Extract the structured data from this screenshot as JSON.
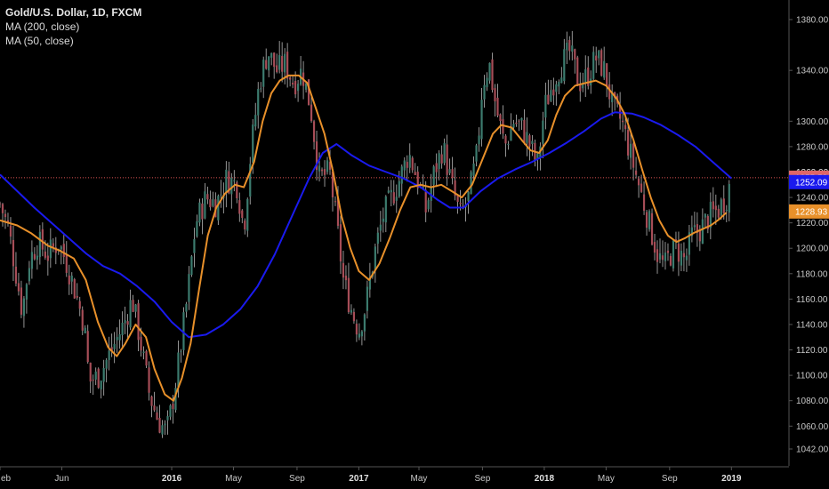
{
  "legend": {
    "title": "Gold/U.S. Dollar, 1D, FXCM",
    "ma200": "MA (200, close)",
    "ma50": "MA (50, close)"
  },
  "colors": {
    "background": "#000000",
    "candle_up": "#3c7b6e",
    "candle_down": "#a64d57",
    "wick": "#b8b8b8",
    "ma200": "#1a1aee",
    "ma50": "#e8902a",
    "price_line": "#e05555",
    "axis": "#555555"
  },
  "chart_data": {
    "type": "line",
    "title": "Gold/U.S. Dollar, 1D, FXCM",
    "xlabel": "",
    "ylabel": "",
    "ylim": [
      1030,
      1390
    ],
    "xlim": [
      0,
      45.9
    ],
    "y_ticks": [
      1042.0,
      1060.0,
      1080.0,
      1100.0,
      1120.0,
      1140.0,
      1160.0,
      1180.0,
      1200.0,
      1220.0,
      1240.0,
      1260.0,
      1280.0,
      1300.0,
      1340.0,
      1380.0
    ],
    "x_ticks": [
      {
        "t": 0,
        "label": "eb",
        "bold": false
      },
      {
        "t": 3.6,
        "label": "Jun",
        "bold": false
      },
      {
        "t": 10.0,
        "label": "2016",
        "bold": true
      },
      {
        "t": 13.6,
        "label": "May",
        "bold": false
      },
      {
        "t": 17.3,
        "label": "Sep",
        "bold": false
      },
      {
        "t": 20.9,
        "label": "2017",
        "bold": true
      },
      {
        "t": 24.4,
        "label": "May",
        "bold": false
      },
      {
        "t": 28.1,
        "label": "Sep",
        "bold": false
      },
      {
        "t": 31.7,
        "label": "2018",
        "bold": true
      },
      {
        "t": 35.3,
        "label": "May",
        "bold": false
      },
      {
        "t": 39.0,
        "label": "Sep",
        "bold": false
      },
      {
        "t": 42.6,
        "label": "2019",
        "bold": true
      }
    ],
    "grid": false,
    "legend_position": "top-left",
    "price": [
      [
        0,
        1235
      ],
      [
        0.5,
        1215
      ],
      [
        1.0,
        1175
      ],
      [
        1.3,
        1150
      ],
      [
        1.7,
        1190
      ],
      [
        2.2,
        1205
      ],
      [
        2.8,
        1195
      ],
      [
        3.4,
        1205
      ],
      [
        3.9,
        1188
      ],
      [
        4.4,
        1165
      ],
      [
        4.9,
        1140
      ],
      [
        5.2,
        1095
      ],
      [
        5.8,
        1100
      ],
      [
        6.5,
        1120
      ],
      [
        7.2,
        1140
      ],
      [
        7.7,
        1160
      ],
      [
        8.2,
        1125
      ],
      [
        8.7,
        1085
      ],
      [
        9.2,
        1065
      ],
      [
        9.7,
        1055
      ],
      [
        10.0,
        1075
      ],
      [
        10.4,
        1110
      ],
      [
        10.9,
        1160
      ],
      [
        11.4,
        1220
      ],
      [
        12.0,
        1240
      ],
      [
        12.6,
        1235
      ],
      [
        13.2,
        1255
      ],
      [
        13.8,
        1250
      ],
      [
        14.2,
        1215
      ],
      [
        14.6,
        1275
      ],
      [
        15.1,
        1330
      ],
      [
        15.6,
        1355
      ],
      [
        16.1,
        1340
      ],
      [
        16.6,
        1345
      ],
      [
        17.1,
        1330
      ],
      [
        17.6,
        1340
      ],
      [
        18.1,
        1310
      ],
      [
        18.6,
        1255
      ],
      [
        19.2,
        1260
      ],
      [
        19.6,
        1220
      ],
      [
        20.0,
        1175
      ],
      [
        20.5,
        1150
      ],
      [
        20.9,
        1135
      ],
      [
        21.3,
        1155
      ],
      [
        21.8,
        1195
      ],
      [
        22.3,
        1225
      ],
      [
        22.8,
        1240
      ],
      [
        23.3,
        1255
      ],
      [
        23.8,
        1275
      ],
      [
        24.3,
        1255
      ],
      [
        24.8,
        1230
      ],
      [
        25.3,
        1260
      ],
      [
        25.8,
        1280
      ],
      [
        26.3,
        1250
      ],
      [
        26.8,
        1225
      ],
      [
        27.3,
        1240
      ],
      [
        27.8,
        1275
      ],
      [
        28.1,
        1330
      ],
      [
        28.5,
        1345
      ],
      [
        28.9,
        1310
      ],
      [
        29.4,
        1280
      ],
      [
        29.9,
        1300
      ],
      [
        30.4,
        1295
      ],
      [
        30.9,
        1280
      ],
      [
        31.3,
        1265
      ],
      [
        31.7,
        1310
      ],
      [
        32.2,
        1330
      ],
      [
        32.7,
        1345
      ],
      [
        33.2,
        1355
      ],
      [
        33.7,
        1330
      ],
      [
        34.2,
        1335
      ],
      [
        34.7,
        1350
      ],
      [
        35.2,
        1340
      ],
      [
        35.7,
        1310
      ],
      [
        36.2,
        1300
      ],
      [
        36.6,
        1280
      ],
      [
        37.1,
        1255
      ],
      [
        37.5,
        1235
      ],
      [
        37.9,
        1215
      ],
      [
        38.3,
        1195
      ],
      [
        38.7,
        1185
      ],
      [
        39.0,
        1195
      ],
      [
        39.4,
        1200
      ],
      [
        39.9,
        1190
      ],
      [
        40.3,
        1210
      ],
      [
        40.8,
        1215
      ],
      [
        41.3,
        1225
      ],
      [
        41.8,
        1230
      ],
      [
        42.3,
        1240
      ],
      [
        42.6,
        1255
      ]
    ],
    "series": [
      {
        "name": "MA (200, close)",
        "color": "#1a1aee",
        "points": [
          [
            0,
            1258
          ],
          [
            1,
            1245
          ],
          [
            2,
            1232
          ],
          [
            3,
            1220
          ],
          [
            4,
            1208
          ],
          [
            5,
            1196
          ],
          [
            6,
            1186
          ],
          [
            7,
            1180
          ],
          [
            8,
            1170
          ],
          [
            9,
            1158
          ],
          [
            10,
            1142
          ],
          [
            11,
            1130
          ],
          [
            12,
            1132
          ],
          [
            13,
            1140
          ],
          [
            14,
            1152
          ],
          [
            15,
            1170
          ],
          [
            16,
            1195
          ],
          [
            17,
            1225
          ],
          [
            18,
            1255
          ],
          [
            18.8,
            1275
          ],
          [
            19.6,
            1282
          ],
          [
            20.5,
            1273
          ],
          [
            21.5,
            1265
          ],
          [
            22.5,
            1260
          ],
          [
            23.5,
            1255
          ],
          [
            24.5,
            1248
          ],
          [
            25.5,
            1238
          ],
          [
            26.2,
            1232
          ],
          [
            27.0,
            1232
          ],
          [
            28.0,
            1245
          ],
          [
            29.0,
            1255
          ],
          [
            30.0,
            1262
          ],
          [
            31.0,
            1268
          ],
          [
            32.0,
            1275
          ],
          [
            33.0,
            1283
          ],
          [
            34.0,
            1292
          ],
          [
            35.0,
            1302
          ],
          [
            35.8,
            1307
          ],
          [
            36.8,
            1306
          ],
          [
            37.5,
            1303
          ],
          [
            38.5,
            1297
          ],
          [
            39.5,
            1289
          ],
          [
            40.5,
            1280
          ],
          [
            41.5,
            1268
          ],
          [
            42.6,
            1255
          ]
        ]
      },
      {
        "name": "MA (50, close)",
        "color": "#e8902a",
        "points": [
          [
            0,
            1222
          ],
          [
            1,
            1218
          ],
          [
            1.8,
            1212
          ],
          [
            2.8,
            1202
          ],
          [
            3.5,
            1198
          ],
          [
            4.3,
            1192
          ],
          [
            5.0,
            1175
          ],
          [
            5.7,
            1142
          ],
          [
            6.3,
            1122
          ],
          [
            6.8,
            1115
          ],
          [
            7.3,
            1125
          ],
          [
            7.9,
            1140
          ],
          [
            8.5,
            1130
          ],
          [
            9.0,
            1105
          ],
          [
            9.6,
            1085
          ],
          [
            10.1,
            1080
          ],
          [
            10.6,
            1098
          ],
          [
            11.1,
            1125
          ],
          [
            11.6,
            1168
          ],
          [
            12.1,
            1210
          ],
          [
            12.6,
            1232
          ],
          [
            13.1,
            1243
          ],
          [
            13.7,
            1250
          ],
          [
            14.2,
            1248
          ],
          [
            14.8,
            1268
          ],
          [
            15.3,
            1300
          ],
          [
            15.8,
            1322
          ],
          [
            16.3,
            1332
          ],
          [
            16.8,
            1336
          ],
          [
            17.4,
            1336
          ],
          [
            17.9,
            1330
          ],
          [
            18.4,
            1310
          ],
          [
            18.9,
            1290
          ],
          [
            19.4,
            1260
          ],
          [
            19.9,
            1225
          ],
          [
            20.4,
            1200
          ],
          [
            20.9,
            1182
          ],
          [
            21.5,
            1175
          ],
          [
            22.1,
            1188
          ],
          [
            22.7,
            1208
          ],
          [
            23.3,
            1230
          ],
          [
            23.9,
            1248
          ],
          [
            24.5,
            1250
          ],
          [
            25.1,
            1248
          ],
          [
            25.7,
            1250
          ],
          [
            26.3,
            1245
          ],
          [
            26.9,
            1240
          ],
          [
            27.5,
            1250
          ],
          [
            28.1,
            1270
          ],
          [
            28.7,
            1290
          ],
          [
            29.2,
            1297
          ],
          [
            29.8,
            1295
          ],
          [
            30.4,
            1285
          ],
          [
            30.9,
            1277
          ],
          [
            31.4,
            1275
          ],
          [
            31.9,
            1285
          ],
          [
            32.4,
            1305
          ],
          [
            32.9,
            1320
          ],
          [
            33.5,
            1328
          ],
          [
            34.1,
            1330
          ],
          [
            34.7,
            1332
          ],
          [
            35.3,
            1328
          ],
          [
            35.9,
            1318
          ],
          [
            36.4,
            1305
          ],
          [
            36.9,
            1285
          ],
          [
            37.4,
            1262
          ],
          [
            37.9,
            1240
          ],
          [
            38.4,
            1222
          ],
          [
            38.9,
            1210
          ],
          [
            39.4,
            1205
          ],
          [
            39.9,
            1208
          ],
          [
            40.4,
            1212
          ],
          [
            40.9,
            1215
          ],
          [
            41.4,
            1218
          ],
          [
            41.9,
            1223
          ],
          [
            42.3,
            1228
          ]
        ]
      }
    ],
    "last_price": {
      "value": 1255.52,
      "label": "1255.52",
      "color": "#e06666"
    },
    "ma200_last": {
      "value": 1252.09,
      "label": "1252.09",
      "color": "#1a1aee"
    },
    "ma50_last": {
      "value": 1228.93,
      "label": "1228.93",
      "color": "#e8902a"
    },
    "partial_top_tick_label": "1260.00"
  }
}
